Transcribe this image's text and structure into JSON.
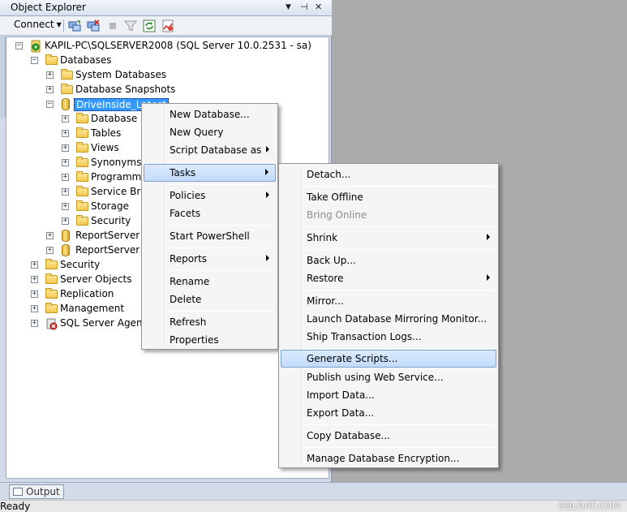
{
  "panel": {
    "title": "Object Explorer",
    "pin_glyph": "▼",
    "autohide_glyph": "⊣",
    "close_glyph": "✕"
  },
  "toolbar": {
    "connect_label": "Connect",
    "connect_arrow": "▼"
  },
  "tree": {
    "server": "KAPIL-PC\\SQLSERVER2008 (SQL Server 10.0.2531 - sa)",
    "databases": "Databases",
    "system_databases": "System Databases",
    "database_snapshots": "Database Snapshots",
    "selected_db": "DriveInside_Latest",
    "db_children": [
      "Database Diagrams",
      "Tables",
      "Views",
      "Synonyms",
      "Programmability",
      "Service Broker",
      "Storage",
      "Security"
    ],
    "report_servers": [
      "ReportServer$SQLSERVER2008",
      "ReportServer$SQLSERVER2008TempDB"
    ],
    "root_items": [
      "Security",
      "Server Objects",
      "Replication",
      "Management",
      "SQL Server Agent"
    ]
  },
  "context_menu": {
    "new_database": "New Database...",
    "new_query": "New Query",
    "script_database_as": "Script Database as",
    "tasks": "Tasks",
    "policies": "Policies",
    "facets": "Facets",
    "start_powershell": "Start PowerShell",
    "reports": "Reports",
    "rename": "Rename",
    "delete": "Delete",
    "refresh": "Refresh",
    "properties": "Properties"
  },
  "tasks_menu": {
    "detach": "Detach...",
    "take_offline": "Take Offline",
    "bring_online": "Bring Online",
    "shrink": "Shrink",
    "back_up": "Back Up...",
    "restore": "Restore",
    "mirror": "Mirror...",
    "launch_mirroring_monitor": "Launch Database Mirroring Monitor...",
    "ship_transaction_logs": "Ship Transaction Logs...",
    "generate_scripts": "Generate Scripts...",
    "publish_web_service": "Publish using Web Service...",
    "import_data": "Import Data...",
    "export_data": "Export Data...",
    "copy_database": "Copy Database...",
    "manage_encryption": "Manage Database Encryption..."
  },
  "bottom": {
    "output_tab": "Output",
    "status": "Ready",
    "watermark": "SQLDAT.COM"
  },
  "colors": {
    "selection": "#3399ff",
    "menu_highlight": "#c1dbfc",
    "panel": "#d4dbe8",
    "doc_area": "#ababab"
  }
}
